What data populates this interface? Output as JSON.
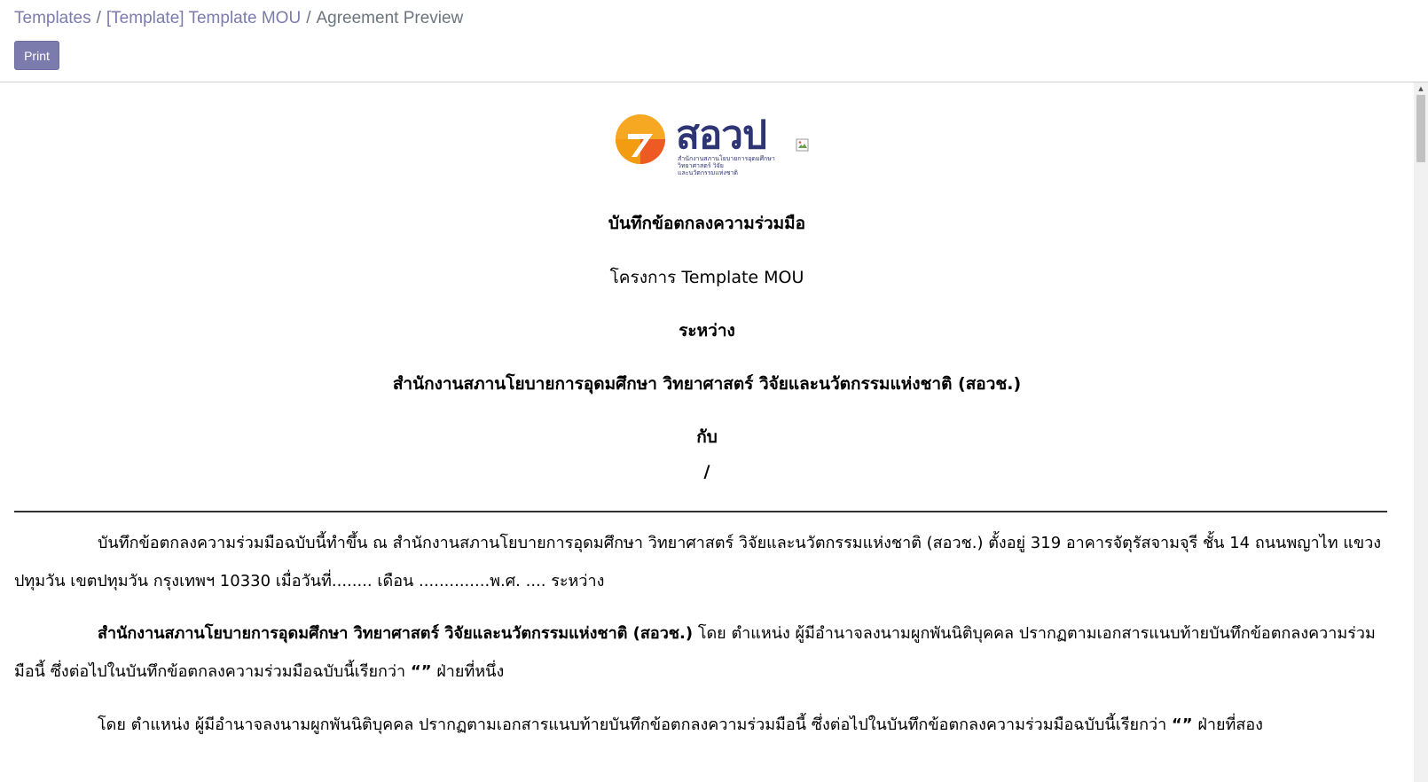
{
  "breadcrumb": {
    "items": [
      "Templates",
      "[Template] Template MOU"
    ],
    "separator": "/",
    "current": "Agreement Preview"
  },
  "toolbar": {
    "print_label": "Print"
  },
  "logo": {
    "wordmark": "สอวป",
    "subtitle": "สำนักงานสภานโยบายการอุดมศึกษา\nวิทยาศาสตร์ วิจัย\nและนวัตกรรมแห่งชาติ",
    "colors": {
      "orange": "#f7a823",
      "red": "#ee5a24",
      "navy": "#2e3575"
    }
  },
  "broken_image_icon": "broken-image-icon",
  "document": {
    "title": "บันทึกข้อตกลงความร่วมมือ",
    "project": "โครงการ Template MOU",
    "between": "ระหว่าง",
    "party_one": "สำนักงานสภานโยบายการอุดมศึกษา วิทยาศาสตร์ วิจัยและนวัตกรรมแห่งชาติ (สอวช.)",
    "with": "กับ",
    "slash": "/",
    "para1": "บันทึกข้อตกลงความร่วมมือฉบับนี้ทำขึ้น ณ สำนักงานสภานโยบายการอุดมศึกษา วิทยาศาสตร์ วิจัยและนวัตกรรมแห่งชาติ (สอวช.) ตั้งอยู่ 319 อาคารจัตุรัสจามจุรี ชั้น 14 ถนนพญาไท แขวงปทุมวัน เขตปทุมวัน กรุงเทพฯ 10330 เมื่อวันที่........ เดือน ..............พ.ศ. .... ระหว่าง",
    "para2_bold": "สำนักงานสภานโยบายการอุดมศึกษา วิทยาศาสตร์ วิจัยและนวัตกรรมแห่งชาติ (สอวช.)",
    "para2_rest": " โดย  ตำแหน่ง  ผู้มีอำนาจลงนามผูกพันนิติบุคคล ปรากฏตามเอกสารแนบท้ายบันทึกข้อตกลงความร่วมมือนี้ ซึ่งต่อไปในบันทึกข้อตกลงความร่วมมือฉบับนี้เรียกว่า ",
    "para2_quote": "“”",
    "para2_end": " ฝ่ายที่หนึ่ง",
    "para3_start": "โดย  ตำแหน่ง  ผู้มีอำนาจลงนามผูกพันนิติบุคคล ปรากฏตามเอกสารแนบท้ายบันทึกข้อตกลงความร่วมมือนี้ ซึ่งต่อไปในบันทึกข้อตกลงความร่วมมือฉบับนี้เรียกว่า ",
    "para3_quote": "“”",
    "para3_end": " ฝ่ายที่สอง"
  }
}
